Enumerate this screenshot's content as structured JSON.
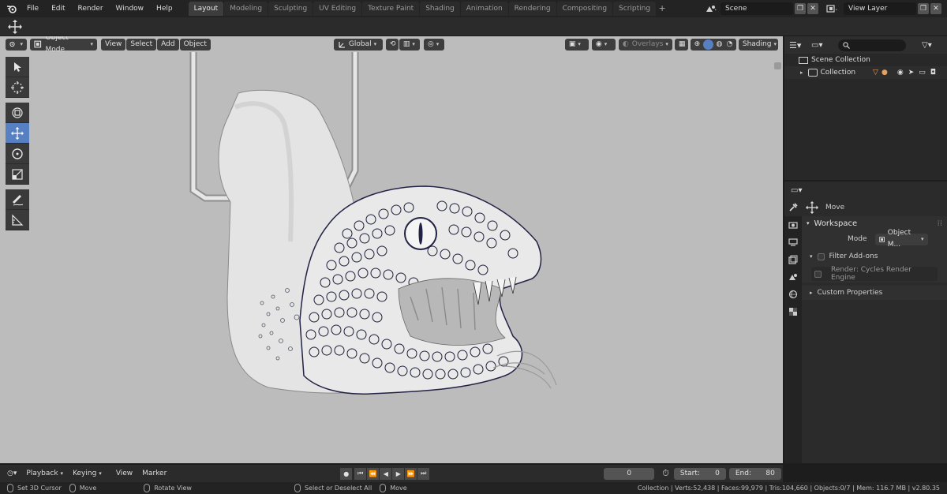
{
  "menu": [
    "File",
    "Edit",
    "Render",
    "Window",
    "Help"
  ],
  "workspace_tabs": [
    {
      "label": "Layout",
      "active": true
    },
    {
      "label": "Modeling"
    },
    {
      "label": "Sculpting"
    },
    {
      "label": "UV Editing"
    },
    {
      "label": "Texture Paint"
    },
    {
      "label": "Shading"
    },
    {
      "label": "Animation"
    },
    {
      "label": "Rendering"
    },
    {
      "label": "Compositing"
    },
    {
      "label": "Scripting"
    }
  ],
  "add_tab_label": "+",
  "scene": {
    "value": "Scene"
  },
  "view_layer": {
    "value": "View Layer"
  },
  "viewport": {
    "mode": "Object Mode",
    "menus": [
      "View",
      "Select",
      "Add",
      "Object"
    ],
    "orientation": "Global",
    "overlays": "Overlays",
    "shading": "Shading"
  },
  "outliner": {
    "scene_collection": "Scene Collection",
    "collection": "Collection"
  },
  "properties": {
    "active_tool": "Move",
    "workspace_title": "Workspace",
    "mode_label": "Mode",
    "mode_value": "Object M...",
    "filter_addons": "Filter Add-ons",
    "addon_row": "Render: Cycles Render Engine",
    "custom_properties": "Custom Properties"
  },
  "timeline": {
    "menus": [
      "Playback",
      "Keying",
      "View",
      "Marker"
    ],
    "current_frame": "0",
    "start_label": "Start:",
    "start_value": "0",
    "end_label": "End:",
    "end_value": "80"
  },
  "status": {
    "hints": [
      "Set 3D Cursor",
      "Move",
      "Rotate View",
      "Select or Deselect All",
      "Move"
    ],
    "stats": "Collection | Verts:52,438 | Faces:99,979 | Tris:104,660 | Objects:0/7 | Mem: 116.7 MB | v2.80.35"
  },
  "colors": {
    "accent": "#5680c2",
    "viewport_bg": "#bcbcbc",
    "panel_bg": "#2b2b2b"
  }
}
